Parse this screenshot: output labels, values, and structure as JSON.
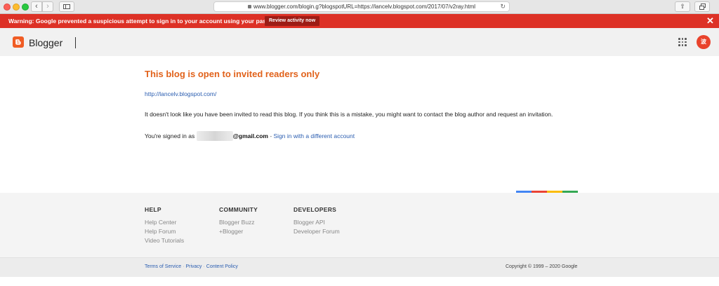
{
  "browser": {
    "url": "www.blogger.com/blogin.g?blogspotURL=https://lancelv.blogspot.com/2017/07/v2ray.html",
    "back_glyph": "‹",
    "forward_glyph": "›",
    "reload_glyph": "↻",
    "share_glyph": "⇧"
  },
  "warning": {
    "text": "Warning: Google prevented a suspicious attempt to sign in to your account using your password.",
    "button": "Review activity now",
    "close": "✕",
    "bg_color": "#dd3126"
  },
  "header": {
    "brand": "Blogger",
    "avatar_initial": "波"
  },
  "main": {
    "title": "This blog is open to invited readers only",
    "blog_url": "http://lancelv.blogspot.com/",
    "message": "It doesn't look like you have been invited to read this blog. If you think this is a mistake, you might want to contact the blog author and request an invitation.",
    "signed_in_prefix": "You're signed in as",
    "email_suffix": "@gmail.com",
    "separator": " - ",
    "switch_account": "Sign in with a different account"
  },
  "footer": {
    "help": {
      "heading": "HELP",
      "links": [
        "Help Center",
        "Help Forum",
        "Video Tutorials"
      ]
    },
    "community": {
      "heading": "COMMUNITY",
      "links": [
        "Blogger Buzz",
        "+Blogger"
      ]
    },
    "developers": {
      "heading": "DEVELOPERS",
      "links": [
        "Blogger API",
        "Developer Forum"
      ]
    },
    "legal": [
      "Terms of Service",
      "Privacy",
      "Content Policy"
    ],
    "legal_separator": "·",
    "copyright": "Copyright © 1999 – 2020 Google"
  },
  "colors": {
    "title": "#e1621b",
    "link": "#2a5db0",
    "blogger_orange": "#f05c24",
    "google_bar": [
      "#4285f4",
      "#ea4335",
      "#fbbc05",
      "#34a853"
    ]
  }
}
